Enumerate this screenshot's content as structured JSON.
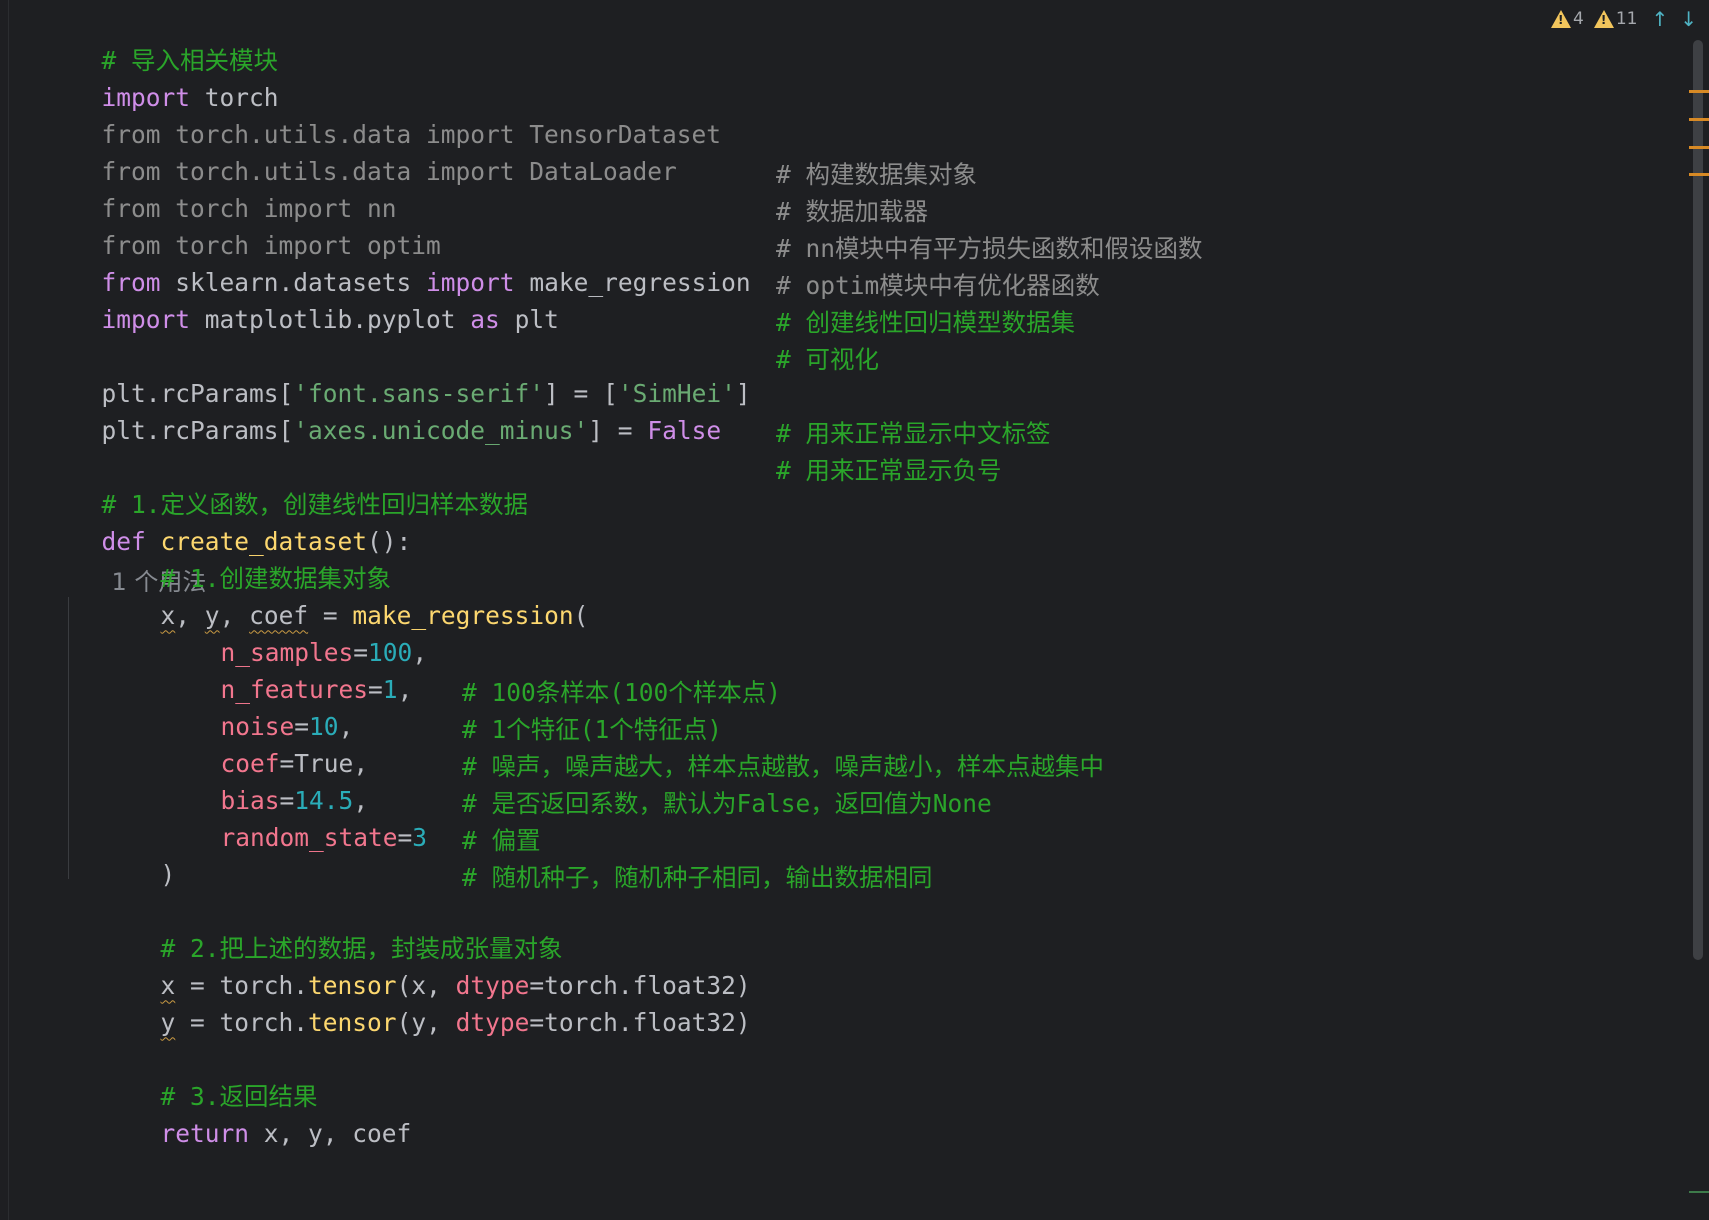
{
  "inspections": {
    "warnings_weak": "4",
    "warnings": "11"
  },
  "code": {
    "l1": "# 导入相关模块",
    "l2_kw": "import",
    "l2_rest": " torch",
    "l3_code": "from torch.utils.data import TensorDataset",
    "l3_cmt": "# 构建数据集对象",
    "l4_code": "from torch.utils.data import DataLoader",
    "l4_cmt": "# 数据加载器",
    "l5_code": "from torch import nn",
    "l5_cmt": "# nn模块中有平方损失函数和假设函数",
    "l6_code": "from torch import optim",
    "l6_cmt": "# optim模块中有优化器函数",
    "l7_kw1": "from",
    "l7_mid": " sklearn.datasets ",
    "l7_kw2": "import",
    "l7_rest": " make_regression",
    "l7_cmt": "# 创建线性回归模型数据集",
    "l8_kw1": "import",
    "l8_mid": " matplotlib.pyplot ",
    "l8_kw2": "as",
    "l8_rest": " plt",
    "l8_cmt": "# 可视化",
    "l10_a": "plt.rcParams[",
    "l10_str1": "'font.sans-serif'",
    "l10_b": "] = [",
    "l10_str2": "'SimHei'",
    "l10_c": "]",
    "l10_cmt": "# 用来正常显示中文标签",
    "l11_a": "plt.rcParams[",
    "l11_str": "'axes.unicode_minus'",
    "l11_b": "] = ",
    "l11_kw": "False",
    "l11_cmt": "# 用来正常显示负号",
    "l13": "# 1.定义函数，创建线性回归样本数据",
    "l14_kw": "def",
    "l14_fn": " create_dataset",
    "l14_rest": "():",
    "l14_hint": "1 个用法",
    "l15": "# 1.创建数据集对象",
    "l16_x": "x",
    "l16_c1": ", ",
    "l16_y": "y",
    "l16_c2": ", ",
    "l16_coef": "coef",
    "l16_eq": " = ",
    "l16_fn": "make_regression",
    "l16_paren": "(",
    "p1_name": "n_samples",
    "p1_eq": "=",
    "p1_val": "100",
    "p1_comma": ",",
    "p1_cmt": "# 100条样本(100个样本点)",
    "p2_name": "n_features",
    "p2_eq": "=",
    "p2_val": "1",
    "p2_comma": ",",
    "p2_cmt": "# 1个特征(1个特征点)",
    "p3_name": "noise",
    "p3_eq": "=",
    "p3_val": "10",
    "p3_comma": ",",
    "p3_cmt": "# 噪声，噪声越大，样本点越散，噪声越小，样本点越集中",
    "p4_name": "coef",
    "p4_eq": "=",
    "p4_val": "True",
    "p4_comma": ",",
    "p4_cmt": "# 是否返回系数，默认为False，返回值为None",
    "p5_name": "bias",
    "p5_eq": "=",
    "p5_val": "14.5",
    "p5_comma": ",",
    "p5_cmt": "# 偏置",
    "p6_name": "random_state",
    "p6_eq": "=",
    "p6_val": "3",
    "p6_cmt": "# 随机种子，随机种子相同，输出数据相同",
    "l23": ")",
    "l25": "# 2.把上述的数据，封装成张量对象",
    "l26_x": "x",
    "l26_a": " = torch.",
    "l26_fn": "tensor",
    "l26_b": "(x, ",
    "l26_param": "dtype",
    "l26_c": "=torch.float32)",
    "l27_y": "y",
    "l27_a": " = torch.",
    "l27_fn": "tensor",
    "l27_b": "(y, ",
    "l27_param": "dtype",
    "l27_c": "=torch.float32)",
    "l29": "# 3.返回结果",
    "l30_kw": "return",
    "l30_rest": " x, y, coef"
  },
  "colors": {
    "background": "#1e1f22",
    "keyword": "#cf8ee8",
    "comment": "#2aa52a",
    "string": "#6aab73",
    "number": "#2aacb8",
    "function": "#fcd76f",
    "parameter": "#f2768e",
    "warning": "#f2c55c"
  },
  "icons": [
    "warning-icon",
    "arrow-up-icon",
    "arrow-down-icon"
  ]
}
